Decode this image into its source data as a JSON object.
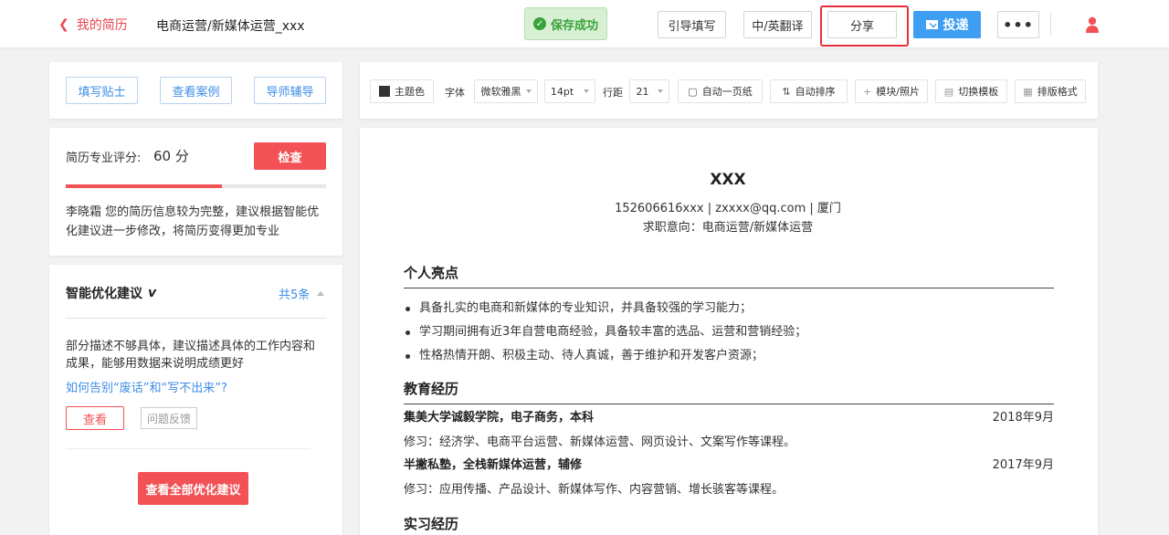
{
  "topbar": {
    "back_label": "我的简历",
    "doc_title": "电商运营/新媒体运营_xxx",
    "save_status": "保存成功",
    "guide_fill": "引导填写",
    "translate": "中/英翻译",
    "share": "分享",
    "deliver": "投递",
    "more": "•••"
  },
  "left": {
    "links": [
      "填写贴士",
      "查看案例",
      "导师辅导"
    ],
    "score": {
      "label": "简历专业评分:",
      "value": "60 分",
      "progress_pct": 60,
      "check_button": "检查",
      "message": "李晓霜 您的简历信息较为完整，建议根据智能优化建议进一步修改，将简历变得更加专业"
    },
    "suggestions": {
      "title": "智能优化建议",
      "badge": "v",
      "count": "共5条",
      "text": "部分描述不够具体，建议描述具体的工作内容和成果，能够用数据来说明成绩更好",
      "link": "如何告别“废话”和“写不出来”?",
      "view_button": "查看",
      "feedback_button": "问题反馈",
      "all_button": "查看全部优化建议"
    }
  },
  "toolbar": {
    "theme_color": "主题色",
    "font_label": "字体",
    "font_value": "微软雅黑",
    "size_value": "14pt",
    "spacing_label": "行距",
    "spacing_value": "21",
    "auto_one_page": "自动一页纸",
    "auto_sort": "自动排序",
    "modules": "模块/照片",
    "switch_template": "切换模板",
    "layout_format": "排版格式"
  },
  "resume": {
    "name": "XXX",
    "contact": "152606616xxx | zxxxx@qq.com | 厦门",
    "intent": "求职意向：电商运营/新媒体运营",
    "highlights_title": "个人亮点",
    "highlights": [
      "具备扎实的电商和新媒体的专业知识，并具备较强的学习能力；",
      "学习期间拥有近3年自营电商经验，具备较丰富的选品、运营和营销经验；",
      "性格热情开朗、积极主动、待人真诚，善于维护和开发客户资源；"
    ],
    "education_title": "教育经历",
    "education": [
      {
        "school": "集美大学诚毅学院，电子商务，本科",
        "date": "2018年9月",
        "desc": "修习：经济学、电商平台运营、新媒体运营、网页设计、文案写作等课程。"
      },
      {
        "school": "半撇私塾，全栈新媒体运营，辅修",
        "date": "2017年9月",
        "desc": "修习：应用传播、产品设计、新媒体写作、内容营销、增长骇客等课程。"
      }
    ],
    "internship_title": "实习经历"
  }
}
